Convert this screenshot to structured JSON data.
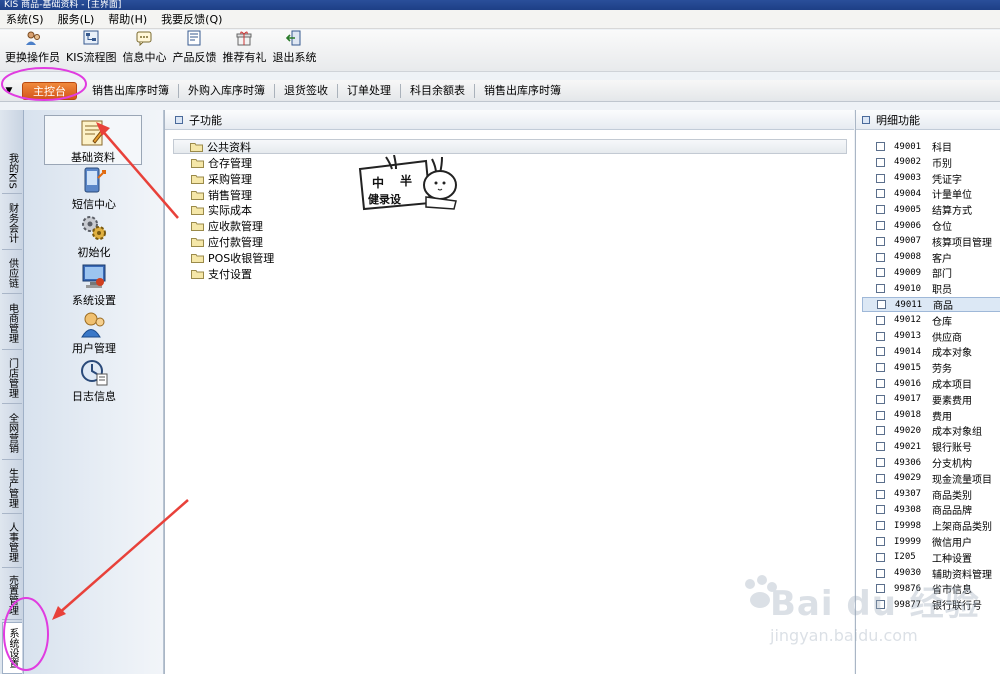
{
  "window": {
    "title": "KIS 商品-基础资料 - [主界面]"
  },
  "menu": [
    "系统(S)",
    "服务(L)",
    "帮助(H)",
    "我要反馈(Q)"
  ],
  "toolbar": [
    {
      "label": "更换操作员",
      "icon": "user-switch-icon"
    },
    {
      "label": "KIS流程图",
      "icon": "flowchart-icon"
    },
    {
      "label": "信息中心",
      "icon": "message-icon"
    },
    {
      "label": "产品反馈",
      "icon": "feedback-icon"
    },
    {
      "label": "推荐有礼",
      "icon": "gift-icon"
    },
    {
      "label": "退出系统",
      "icon": "exit-icon"
    }
  ],
  "tabs": {
    "main": "主控台",
    "items": [
      "销售出库序时簿",
      "外购入库序时簿",
      "退货签收",
      "订单处理",
      "科目余额表",
      "销售出库序时簿"
    ]
  },
  "vertical_tabs": [
    "我的KIS",
    "财务会计",
    "供应链",
    "电商管理",
    "门店管理",
    "全网营销",
    "生产管理",
    "人事管理",
    "売置管理",
    "系统设置"
  ],
  "modules": [
    {
      "label": "基础资料",
      "icon": "base-data-icon"
    },
    {
      "label": "短信中心",
      "icon": "sms-icon"
    },
    {
      "label": "初始化",
      "icon": "init-icon"
    },
    {
      "label": "系统设置",
      "icon": "settings-icon"
    },
    {
      "label": "用户管理",
      "icon": "user-manage-icon"
    },
    {
      "label": "日志信息",
      "icon": "log-icon"
    }
  ],
  "sub_panel": {
    "title": "子功能",
    "root": "公共资料",
    "items": [
      "仓存管理",
      "采购管理",
      "销售管理",
      "实际成本",
      "应收款管理",
      "应付款管理",
      "POS收银管理",
      "支付设置"
    ]
  },
  "stamp": {
    "line1": "中",
    "line2": "半",
    "line3": "健录设"
  },
  "detail_panel": {
    "title": "明细功能",
    "items": [
      {
        "code": "49001",
        "name": "科目"
      },
      {
        "code": "49002",
        "name": "币别"
      },
      {
        "code": "49003",
        "name": "凭证字"
      },
      {
        "code": "49004",
        "name": "计量单位"
      },
      {
        "code": "49005",
        "name": "结算方式"
      },
      {
        "code": "49006",
        "name": "仓位"
      },
      {
        "code": "49007",
        "name": "核算项目管理"
      },
      {
        "code": "49008",
        "name": "客户"
      },
      {
        "code": "49009",
        "name": "部门"
      },
      {
        "code": "49010",
        "name": "职员"
      },
      {
        "code": "49011",
        "name": "商品"
      },
      {
        "code": "49012",
        "name": "仓库"
      },
      {
        "code": "49013",
        "name": "供应商"
      },
      {
        "code": "49014",
        "name": "成本对象"
      },
      {
        "code": "49015",
        "name": "劳务"
      },
      {
        "code": "49016",
        "name": "成本项目"
      },
      {
        "code": "49017",
        "name": "要素费用"
      },
      {
        "code": "49018",
        "name": "费用"
      },
      {
        "code": "49020",
        "name": "成本对象组"
      },
      {
        "code": "49021",
        "name": "银行账号"
      },
      {
        "code": "49306",
        "name": "分支机构"
      },
      {
        "code": "49029",
        "name": "现金流量项目"
      },
      {
        "code": "49307",
        "name": "商品类别"
      },
      {
        "code": "49308",
        "name": "商品品牌"
      },
      {
        "code": "I9998",
        "name": "上架商品类别"
      },
      {
        "code": "I9999",
        "name": "微信用户"
      },
      {
        "code": "I205",
        "name": "工种设置"
      },
      {
        "code": "49030",
        "name": "辅助资料管理"
      },
      {
        "code": "99876",
        "name": "省市信息"
      },
      {
        "code": "99877",
        "name": "银行联行号"
      }
    ]
  },
  "watermark": {
    "brand": "Bai du 经验",
    "url": "jingyan.baidu.com"
  },
  "colors": {
    "accent_tab": "#e0662a",
    "annotation": "#e8413a",
    "highlight_circle": "#e03ce0"
  }
}
